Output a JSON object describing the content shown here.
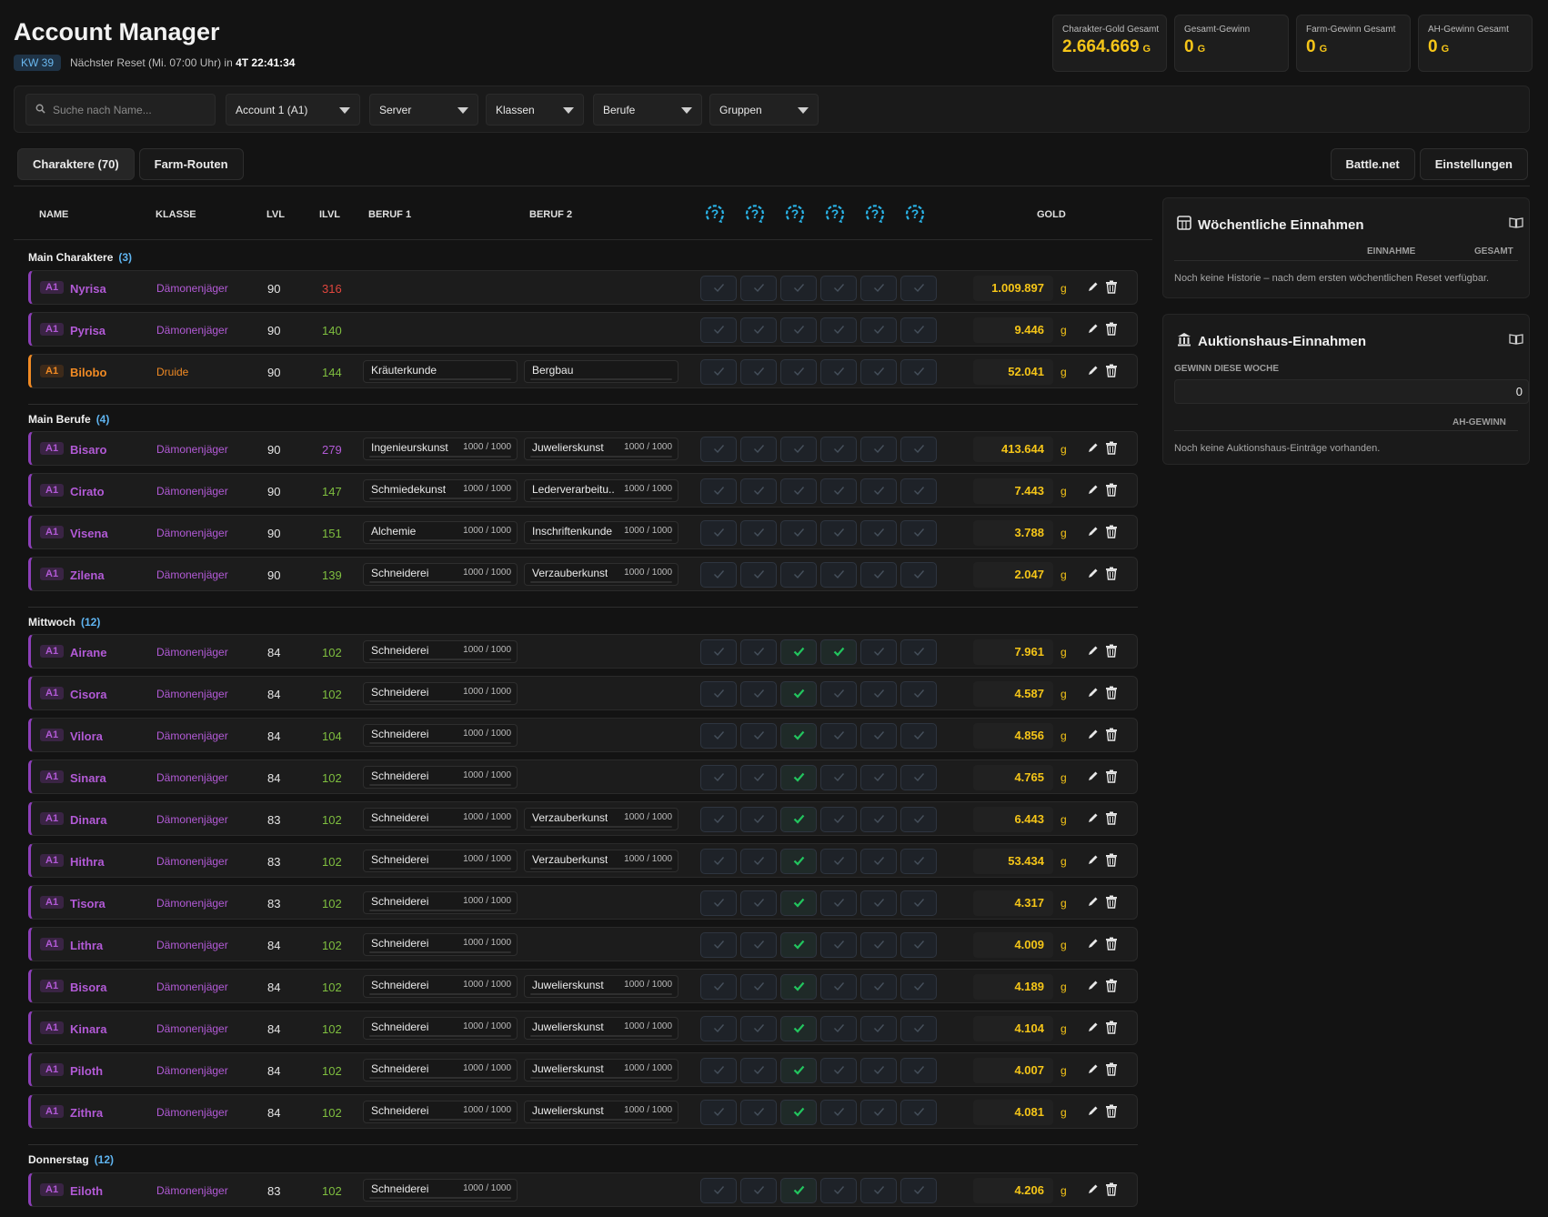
{
  "header": {
    "title": "Account Manager",
    "week_badge": "KW 39",
    "reset_text": "Nächster Reset (Mi. 07:00 Uhr) in",
    "countdown": "4T 22:41:34"
  },
  "stats": [
    {
      "label": "Charakter-Gold Gesamt",
      "value": "2.664.669",
      "unit": "G"
    },
    {
      "label": "Gesamt-Gewinn",
      "value": "0",
      "unit": "G"
    },
    {
      "label": "Farm-Gewinn Gesamt",
      "value": "0",
      "unit": "G"
    },
    {
      "label": "AH-Gewinn Gesamt",
      "value": "0",
      "unit": "G"
    }
  ],
  "filters": {
    "search_placeholder": "Suche nach Name...",
    "account": "Account 1 (A1)",
    "server": "Server",
    "classes": "Klassen",
    "professions": "Berufe",
    "groups": "Gruppen"
  },
  "tabs": {
    "characters": "Charaktere (70)",
    "farm_routes": "Farm-Routen"
  },
  "top_buttons": {
    "battlenet": "Battle.net",
    "settings": "Einstellungen"
  },
  "table_headers": {
    "name": "NAME",
    "class": "KLASSE",
    "lvl": "LVL",
    "ilvl": "ILVL",
    "prof1": "BERUF 1",
    "prof2": "BERUF 2",
    "gold": "GOLD"
  },
  "gold_unit": "g",
  "colors": {
    "accent_gold": "#f5c518",
    "dh_purple": "#b25ad6",
    "druid_orange": "#f08a24",
    "check_green": "#22c55e",
    "quest_blue": "#2ab4e8"
  },
  "groups": [
    {
      "title": "Main Charaktere",
      "count": "(3)",
      "rows": [
        {
          "acct": "A1",
          "name": "Nyrisa",
          "class": "Dämonenjäger",
          "lvl": "90",
          "ilvl": "316",
          "ilvl_color": "red",
          "p1": "",
          "p1s": "",
          "p2": "",
          "p2s": "",
          "checks": [
            0,
            0,
            0,
            0,
            0,
            0
          ],
          "gold": "1.009.897",
          "style": "dh"
        },
        {
          "acct": "A1",
          "name": "Pyrisa",
          "class": "Dämonenjäger",
          "lvl": "90",
          "ilvl": "140",
          "ilvl_color": "green",
          "p1": "",
          "p1s": "",
          "p2": "",
          "p2s": "",
          "checks": [
            0,
            0,
            0,
            0,
            0,
            0
          ],
          "gold": "9.446",
          "style": "dh"
        },
        {
          "acct": "A1",
          "name": "Bilobo",
          "class": "Druide",
          "lvl": "90",
          "ilvl": "144",
          "ilvl_color": "green",
          "p1": "Kräuterkunde",
          "p1s": "",
          "p2": "Bergbau",
          "p2s": "",
          "checks": [
            0,
            0,
            0,
            0,
            0,
            0
          ],
          "gold": "52.041",
          "style": "druid"
        }
      ]
    },
    {
      "title": "Main Berufe",
      "count": "(4)",
      "rows": [
        {
          "acct": "A1",
          "name": "Bisaro",
          "class": "Dämonenjäger",
          "lvl": "90",
          "ilvl": "279",
          "ilvl_color": "purple",
          "p1": "Ingenieurskunst",
          "p1s": "1000 / 1000",
          "p2": "Juwelierskunst",
          "p2s": "1000 / 1000",
          "checks": [
            0,
            0,
            0,
            0,
            0,
            0
          ],
          "gold": "413.644",
          "style": "dh"
        },
        {
          "acct": "A1",
          "name": "Cirato",
          "class": "Dämonenjäger",
          "lvl": "90",
          "ilvl": "147",
          "ilvl_color": "green",
          "p1": "Schmiedekunst",
          "p1s": "1000 / 1000",
          "p2": "Lederverarbeitu...",
          "p2s": "1000 / 1000",
          "checks": [
            0,
            0,
            0,
            0,
            0,
            0
          ],
          "gold": "7.443",
          "style": "dh"
        },
        {
          "acct": "A1",
          "name": "Visena",
          "class": "Dämonenjäger",
          "lvl": "90",
          "ilvl": "151",
          "ilvl_color": "green",
          "p1": "Alchemie",
          "p1s": "1000 / 1000",
          "p2": "Inschriftenkunde",
          "p2s": "1000 / 1000",
          "checks": [
            0,
            0,
            0,
            0,
            0,
            0
          ],
          "gold": "3.788",
          "style": "dh"
        },
        {
          "acct": "A1",
          "name": "Zilena",
          "class": "Dämonenjäger",
          "lvl": "90",
          "ilvl": "139",
          "ilvl_color": "green",
          "p1": "Schneiderei",
          "p1s": "1000 / 1000",
          "p2": "Verzauberkunst",
          "p2s": "1000 / 1000",
          "checks": [
            0,
            0,
            0,
            0,
            0,
            0
          ],
          "gold": "2.047",
          "style": "dh"
        }
      ]
    },
    {
      "title": "Mittwoch",
      "count": "(12)",
      "rows": [
        {
          "acct": "A1",
          "name": "Airane",
          "class": "Dämonenjäger",
          "lvl": "84",
          "ilvl": "102",
          "ilvl_color": "green",
          "p1": "Schneiderei",
          "p1s": "1000 / 1000",
          "p2": "",
          "p2s": "",
          "checks": [
            0,
            0,
            1,
            1,
            0,
            0
          ],
          "gold": "7.961",
          "style": "dh"
        },
        {
          "acct": "A1",
          "name": "Cisora",
          "class": "Dämonenjäger",
          "lvl": "84",
          "ilvl": "102",
          "ilvl_color": "green",
          "p1": "Schneiderei",
          "p1s": "1000 / 1000",
          "p2": "",
          "p2s": "",
          "checks": [
            0,
            0,
            1,
            0,
            0,
            0
          ],
          "gold": "4.587",
          "style": "dh"
        },
        {
          "acct": "A1",
          "name": "Vilora",
          "class": "Dämonenjäger",
          "lvl": "84",
          "ilvl": "104",
          "ilvl_color": "green",
          "p1": "Schneiderei",
          "p1s": "1000 / 1000",
          "p2": "",
          "p2s": "",
          "checks": [
            0,
            0,
            1,
            0,
            0,
            0
          ],
          "gold": "4.856",
          "style": "dh"
        },
        {
          "acct": "A1",
          "name": "Sinara",
          "class": "Dämonenjäger",
          "lvl": "84",
          "ilvl": "102",
          "ilvl_color": "green",
          "p1": "Schneiderei",
          "p1s": "1000 / 1000",
          "p2": "",
          "p2s": "",
          "checks": [
            0,
            0,
            1,
            0,
            0,
            0
          ],
          "gold": "4.765",
          "style": "dh"
        },
        {
          "acct": "A1",
          "name": "Dinara",
          "class": "Dämonenjäger",
          "lvl": "83",
          "ilvl": "102",
          "ilvl_color": "green",
          "p1": "Schneiderei",
          "p1s": "1000 / 1000",
          "p2": "Verzauberkunst",
          "p2s": "1000 / 1000",
          "checks": [
            0,
            0,
            1,
            0,
            0,
            0
          ],
          "gold": "6.443",
          "style": "dh"
        },
        {
          "acct": "A1",
          "name": "Hithra",
          "class": "Dämonenjäger",
          "lvl": "83",
          "ilvl": "102",
          "ilvl_color": "green",
          "p1": "Schneiderei",
          "p1s": "1000 / 1000",
          "p2": "Verzauberkunst",
          "p2s": "1000 / 1000",
          "checks": [
            0,
            0,
            1,
            0,
            0,
            0
          ],
          "gold": "53.434",
          "style": "dh"
        },
        {
          "acct": "A1",
          "name": "Tisora",
          "class": "Dämonenjäger",
          "lvl": "83",
          "ilvl": "102",
          "ilvl_color": "green",
          "p1": "Schneiderei",
          "p1s": "1000 / 1000",
          "p2": "",
          "p2s": "",
          "checks": [
            0,
            0,
            1,
            0,
            0,
            0
          ],
          "gold": "4.317",
          "style": "dh"
        },
        {
          "acct": "A1",
          "name": "Lithra",
          "class": "Dämonenjäger",
          "lvl": "84",
          "ilvl": "102",
          "ilvl_color": "green",
          "p1": "Schneiderei",
          "p1s": "1000 / 1000",
          "p2": "",
          "p2s": "",
          "checks": [
            0,
            0,
            1,
            0,
            0,
            0
          ],
          "gold": "4.009",
          "style": "dh"
        },
        {
          "acct": "A1",
          "name": "Bisora",
          "class": "Dämonenjäger",
          "lvl": "84",
          "ilvl": "102",
          "ilvl_color": "green",
          "p1": "Schneiderei",
          "p1s": "1000 / 1000",
          "p2": "Juwelierskunst",
          "p2s": "1000 / 1000",
          "checks": [
            0,
            0,
            1,
            0,
            0,
            0
          ],
          "gold": "4.189",
          "style": "dh"
        },
        {
          "acct": "A1",
          "name": "Kinara",
          "class": "Dämonenjäger",
          "lvl": "84",
          "ilvl": "102",
          "ilvl_color": "green",
          "p1": "Schneiderei",
          "p1s": "1000 / 1000",
          "p2": "Juwelierskunst",
          "p2s": "1000 / 1000",
          "checks": [
            0,
            0,
            1,
            0,
            0,
            0
          ],
          "gold": "4.104",
          "style": "dh"
        },
        {
          "acct": "A1",
          "name": "Piloth",
          "class": "Dämonenjäger",
          "lvl": "84",
          "ilvl": "102",
          "ilvl_color": "green",
          "p1": "Schneiderei",
          "p1s": "1000 / 1000",
          "p2": "Juwelierskunst",
          "p2s": "1000 / 1000",
          "checks": [
            0,
            0,
            1,
            0,
            0,
            0
          ],
          "gold": "4.007",
          "style": "dh"
        },
        {
          "acct": "A1",
          "name": "Zithra",
          "class": "Dämonenjäger",
          "lvl": "84",
          "ilvl": "102",
          "ilvl_color": "green",
          "p1": "Schneiderei",
          "p1s": "1000 / 1000",
          "p2": "Juwelierskunst",
          "p2s": "1000 / 1000",
          "checks": [
            0,
            0,
            1,
            0,
            0,
            0
          ],
          "gold": "4.081",
          "style": "dh"
        }
      ]
    },
    {
      "title": "Donnerstag",
      "count": "(12)",
      "rows": [
        {
          "acct": "A1",
          "name": "Eiloth",
          "class": "Dämonenjäger",
          "lvl": "83",
          "ilvl": "102",
          "ilvl_color": "green",
          "p1": "Schneiderei",
          "p1s": "1000 / 1000",
          "p2": "",
          "p2s": "",
          "checks": [
            0,
            0,
            1,
            0,
            0,
            0
          ],
          "gold": "4.206",
          "style": "dh"
        }
      ]
    }
  ],
  "weekly": {
    "title": "Wöchentliche Einnahmen",
    "col_income": "EINNAHME",
    "col_total": "GESAMT",
    "note": "Noch keine Historie – nach dem ersten wöchentlichen Reset verfügbar."
  },
  "auction": {
    "title": "Auktionshaus-Einnahmen",
    "week_label": "GEWINN DIESE WOCHE",
    "week_value": "0",
    "col_ah": "AH-GEWINN",
    "note": "Noch keine Auktionshaus-Einträge vorhanden."
  }
}
